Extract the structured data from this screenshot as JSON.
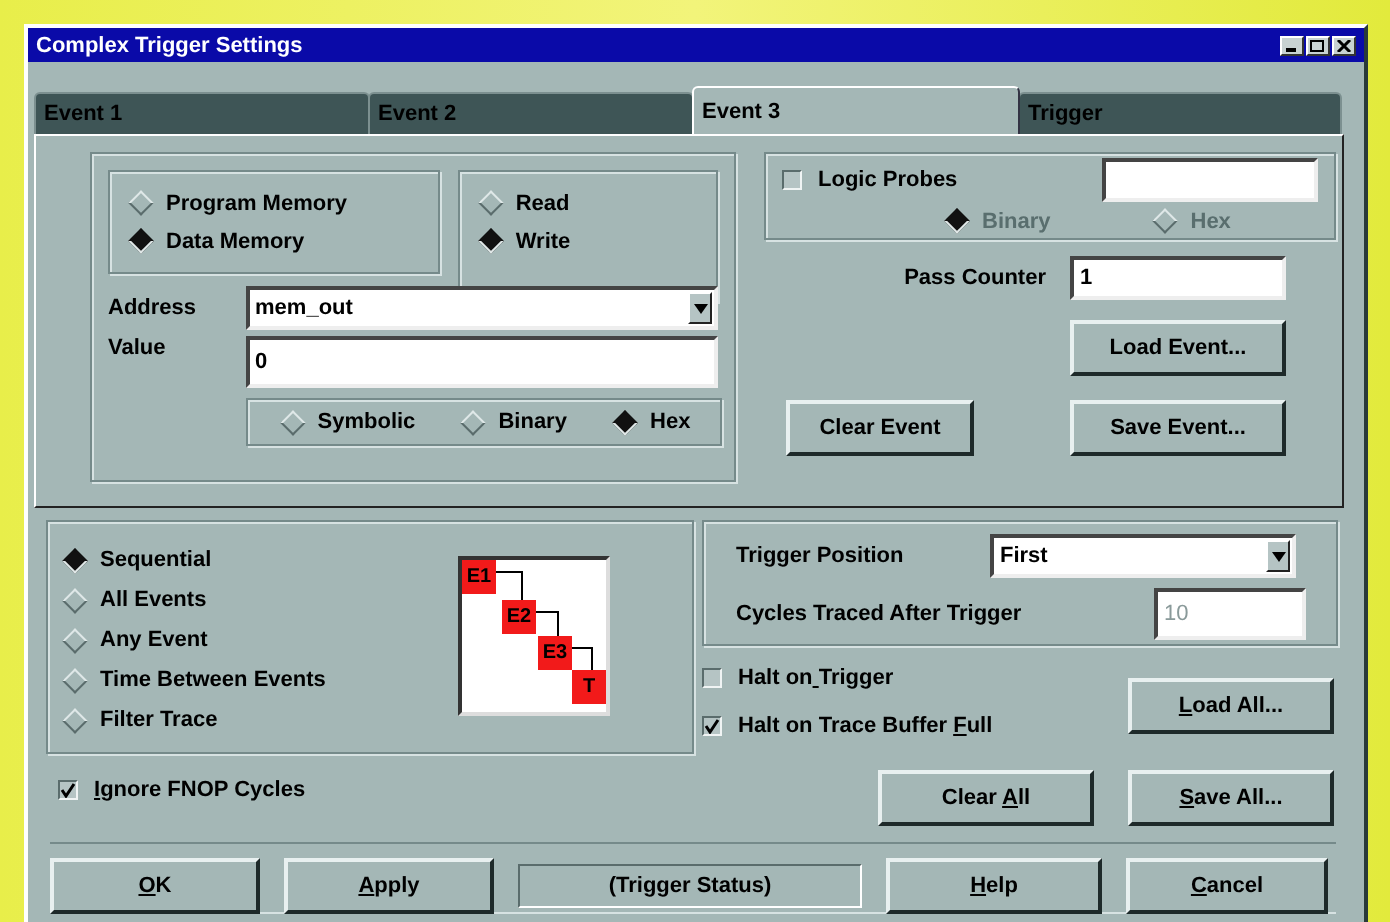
{
  "window": {
    "title": "Complex Trigger Settings"
  },
  "tabs": [
    {
      "label": "Event 1",
      "selected": false
    },
    {
      "label": "Event 2",
      "selected": false
    },
    {
      "label": "Event 3",
      "selected": true
    },
    {
      "label": "Trigger",
      "selected": false
    }
  ],
  "memory_type": [
    {
      "label": "Program Memory",
      "selected": false
    },
    {
      "label": "Data Memory",
      "selected": true
    }
  ],
  "access": [
    {
      "label": "Read",
      "selected": false
    },
    {
      "label": "Write",
      "selected": true
    }
  ],
  "address": {
    "label": "Address",
    "value": "mem_out"
  },
  "value": {
    "label": "Value",
    "value": "0"
  },
  "value_format": [
    {
      "label": "Symbolic",
      "selected": false
    },
    {
      "label": "Binary",
      "selected": false
    },
    {
      "label": "Hex",
      "selected": true
    }
  ],
  "logic_probes": {
    "label": "Logic Probes",
    "checked": false,
    "formats_disabled": true,
    "formats": [
      {
        "label": "Binary",
        "selected": true
      },
      {
        "label": "Hex",
        "selected": false
      }
    ]
  },
  "pass_counter": {
    "label": "Pass Counter",
    "value": "1"
  },
  "event_buttons": {
    "load": "Load Event...",
    "clear": "Clear Event",
    "save": "Save Event..."
  },
  "sequence_modes": [
    {
      "label": "Sequential",
      "selected": true
    },
    {
      "label": "All Events",
      "selected": false
    },
    {
      "label": "Any Event",
      "selected": false
    },
    {
      "label": "Time Between Events",
      "selected": false
    },
    {
      "label": "Filter Trace",
      "selected": false
    }
  ],
  "sequence_diagram": [
    "E1",
    "E2",
    "E3",
    "T"
  ],
  "trigger_position": {
    "label": "Trigger Position",
    "value": "First"
  },
  "cycles_after_trigger": {
    "label": "Cycles Traced After Trigger",
    "value": "10",
    "disabled": true
  },
  "halt_options": [
    {
      "label": "Halt on Trigger",
      "checked": false
    },
    {
      "label": "Halt on Trace Buffer Full",
      "checked": true
    }
  ],
  "ignore_fnop": {
    "label": "Ignore FNOP Cycles",
    "checked": true
  },
  "side_buttons": {
    "load": "Load All...",
    "clear": "Clear All",
    "save": "Save All..."
  },
  "footer": {
    "ok": "OK",
    "apply": "Apply",
    "status": "(Trigger Status)",
    "help": "Help",
    "cancel": "Cancel"
  }
}
